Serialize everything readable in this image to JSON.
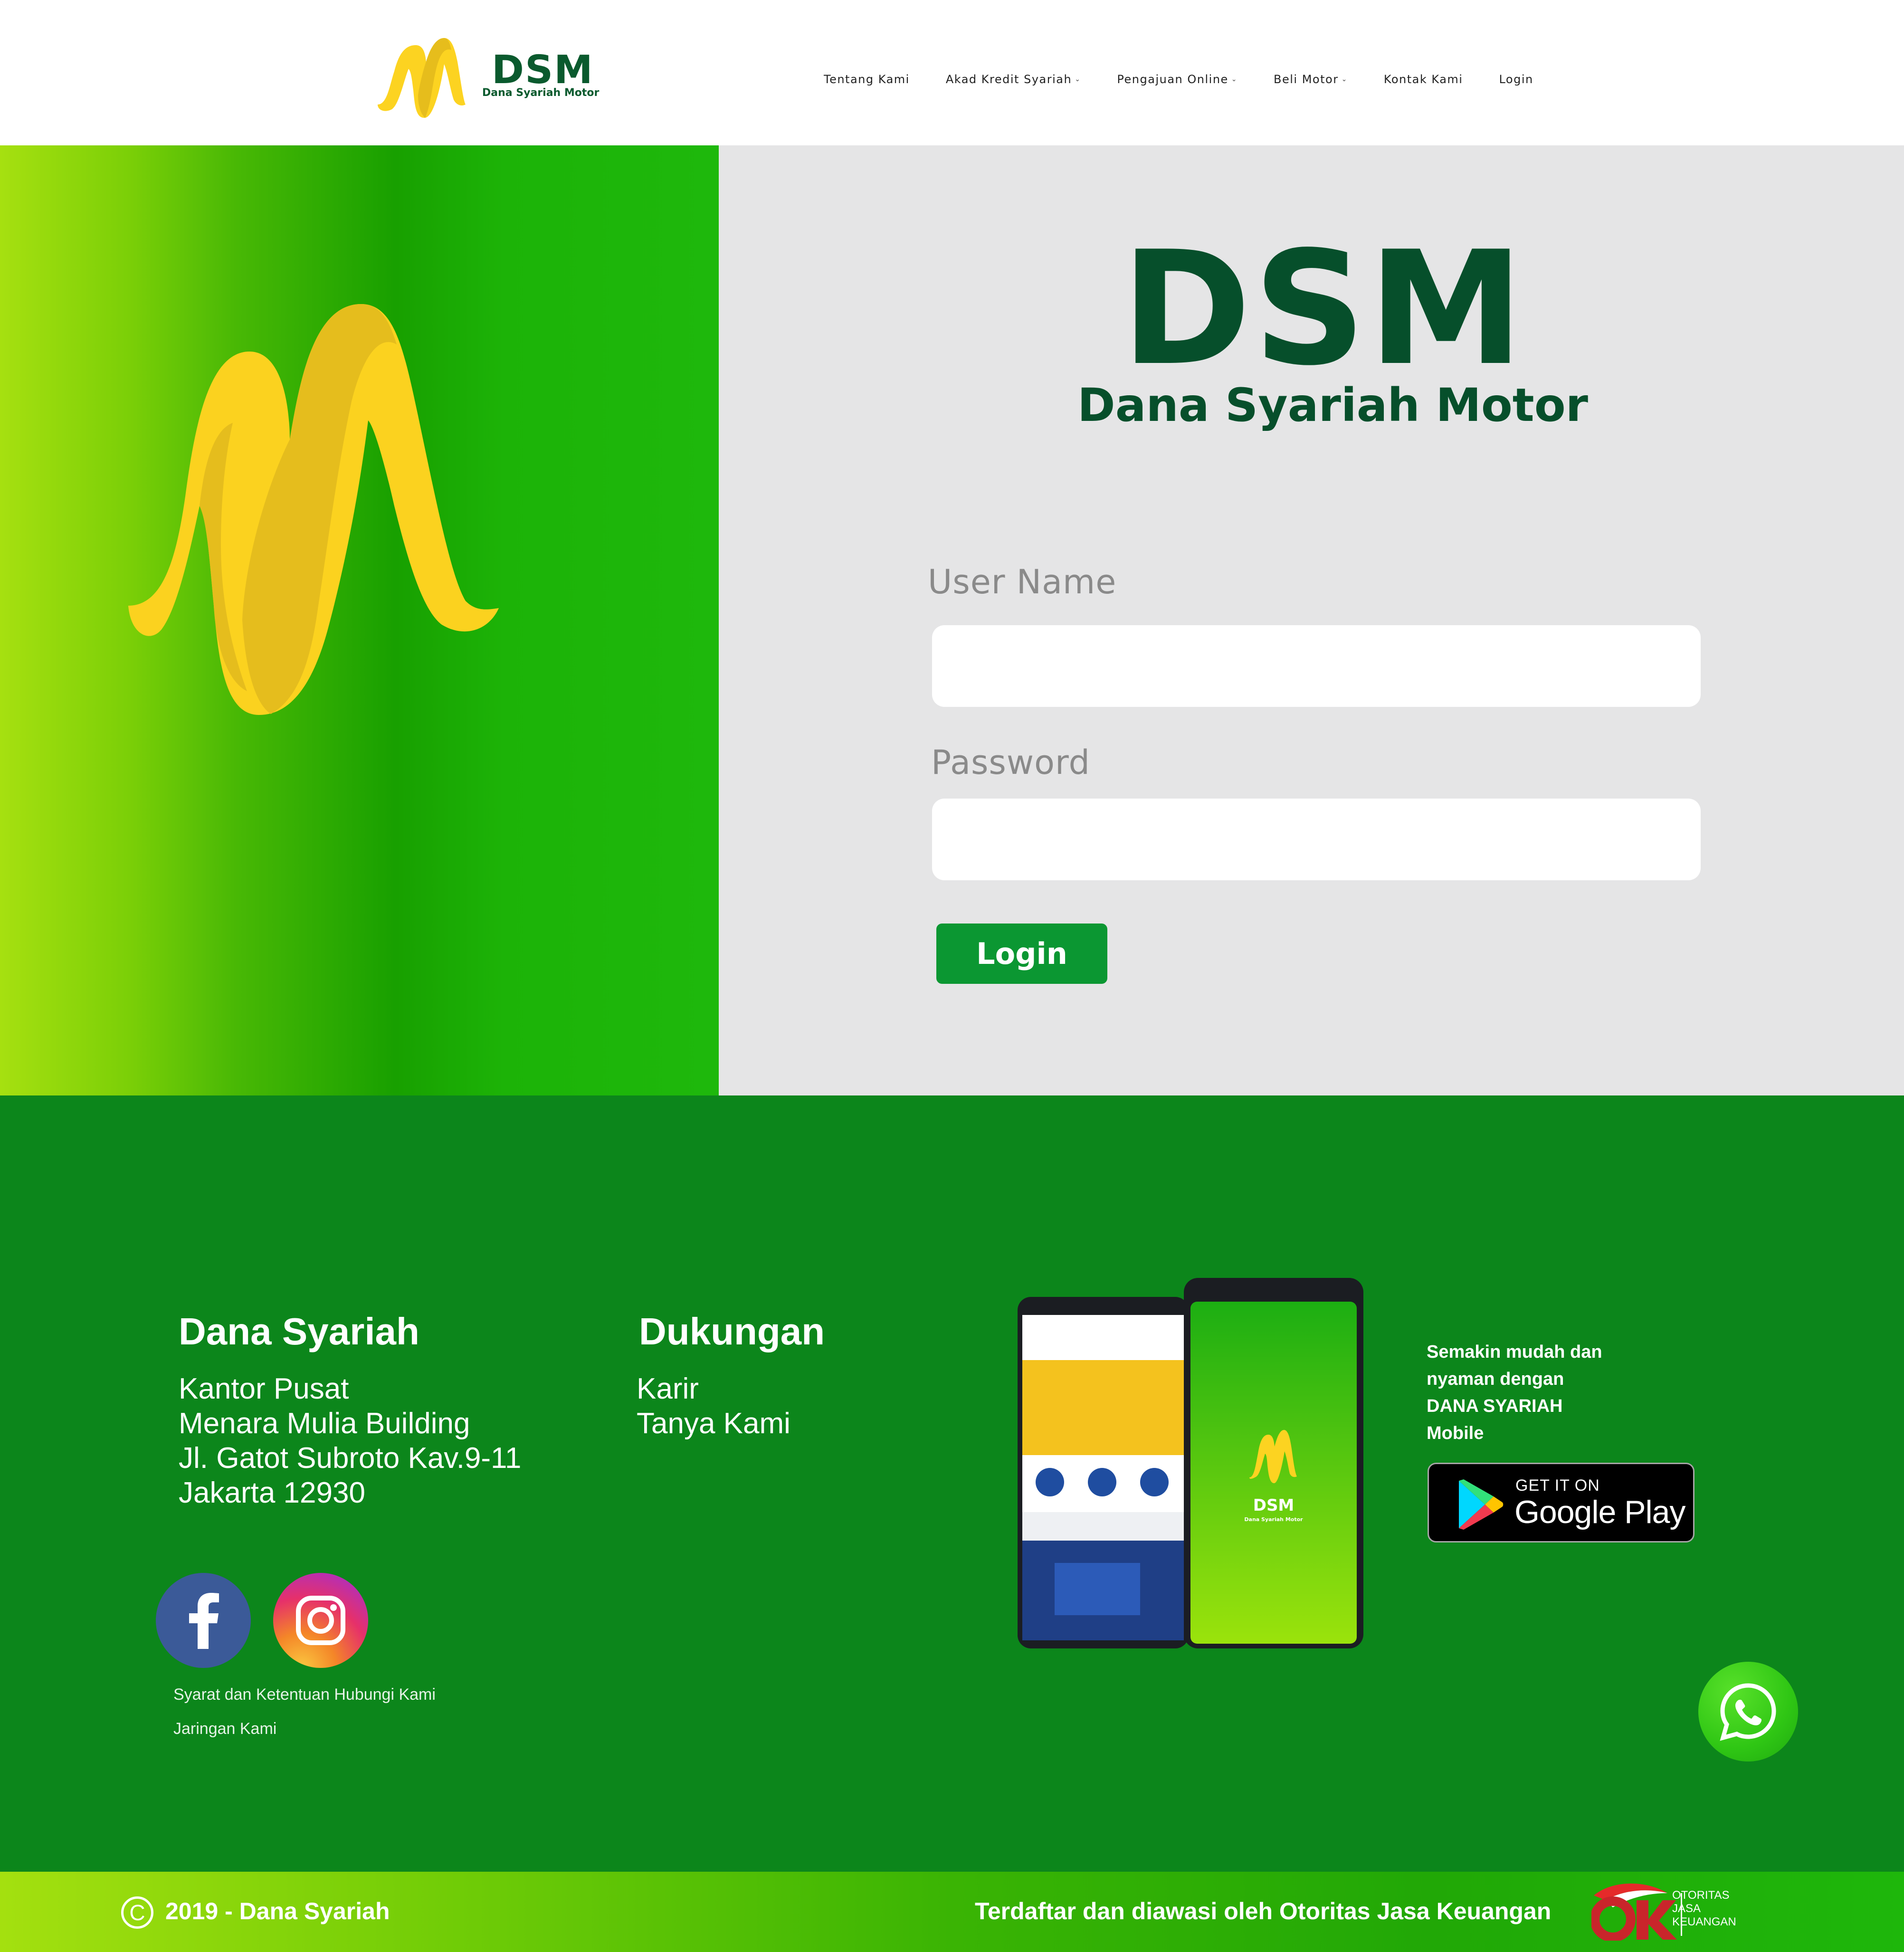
{
  "header": {
    "brand_name": "DSM",
    "brand_tagline": "Dana Syariah Motor",
    "nav": [
      {
        "label": "Tentang Kami",
        "dropdown": false
      },
      {
        "label": "Akad Kredit Syariah",
        "dropdown": true
      },
      {
        "label": "Pengajuan Online",
        "dropdown": true
      },
      {
        "label": "Beli Motor",
        "dropdown": true
      },
      {
        "label": "Kontak Kami",
        "dropdown": false
      },
      {
        "label": "Login",
        "dropdown": false
      }
    ]
  },
  "login": {
    "title": "DSM",
    "subtitle": "Dana Syariah Motor",
    "username_label": "User Name",
    "username_value": "",
    "password_label": "Password",
    "password_value": "",
    "submit_label": "Login"
  },
  "footer": {
    "dana_syariah": {
      "title": "Dana Syariah",
      "lines": [
        "Kantor Pusat",
        "Menara Mulia Building",
        "Jl. Gatot Subroto Kav.9-11",
        "Jakarta 12930"
      ]
    },
    "dukungan": {
      "title": "Dukungan",
      "links": [
        "Karir",
        "Tanya Kami"
      ]
    },
    "social": [
      "facebook-icon",
      "instagram-icon"
    ],
    "links_row1": "Syarat dan Ketentuan Hubungi Kami",
    "links_row2": "Jaringan Kami",
    "app_phone_brand": "DSM",
    "app_phone_tagline": "Dana Syariah Motor",
    "promo_lines": [
      "Semakin mudah dan",
      "nyaman dengan",
      "DANA SYARIAH",
      "Mobile"
    ],
    "store_badge": {
      "small": "GET IT ON",
      "big": "Google Play"
    }
  },
  "bottom": {
    "copyright_symbol": "C",
    "copyright": "2019 - Dana Syariah",
    "regulator_text": "Terdaftar dan diawasi oleh Otoritas Jasa Keuangan",
    "ojk_words": [
      "OTORITAS",
      "JASA",
      "KEUANGAN"
    ]
  },
  "colors": {
    "brand_dark_green": "#064f2b",
    "brand_yellow": "#fcd321",
    "login_button": "#0b9732",
    "footer_green": "#0c861b",
    "hero_panel_gray": "#e5e5e6"
  }
}
